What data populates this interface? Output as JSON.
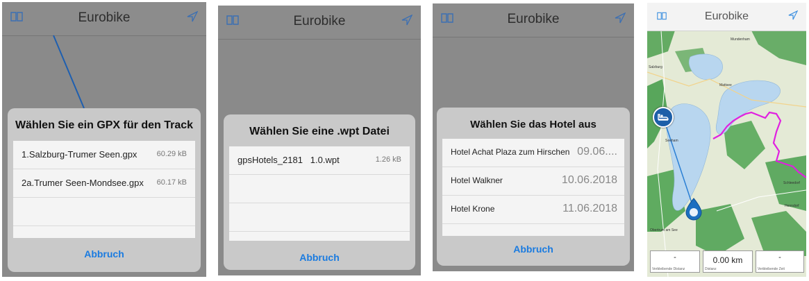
{
  "app_title": "Eurobike",
  "gpx_picker": {
    "title": "Wählen Sie ein GPX für den Track",
    "files": [
      {
        "name": "1.Salzburg-Trumer Seen.gpx",
        "size": "60.29 kB"
      },
      {
        "name": "2a.Trumer Seen-Mondsee.gpx",
        "size": "60.17 kB"
      }
    ],
    "cancel": "Abbruch"
  },
  "wpt_picker": {
    "title": "Wählen Sie eine .wpt Datei",
    "files": [
      {
        "name": "gpsHotels_2181   1.0.wpt",
        "size": "1.26 kB"
      }
    ],
    "cancel": "Abbruch"
  },
  "hotel_picker": {
    "title": "Wählen Sie das Hotel aus",
    "hotels": [
      {
        "name": "Hotel Achat Plaza zum Hirschen",
        "date": "09.06...."
      },
      {
        "name": "Hotel Walkner",
        "date": "10.06.2018"
      },
      {
        "name": "Hotel Krone",
        "date": "11.06.2018"
      }
    ],
    "cancel": "Abbruch"
  },
  "map": {
    "distance_value": "0.00 km",
    "remaining_distance_value": "-",
    "remaining_distance_label": "Verbleibende Distanz",
    "distance_label": "Distanz",
    "remaining_time_value": "-",
    "remaining_time_label": "Verbleibende Zeit",
    "place_labels": [
      "Salzburg",
      "Seeham",
      "Obertrum am See",
      "Mattsee",
      "Schleedorf",
      "Henndorf",
      "Mundenham"
    ],
    "colors": {
      "track": "#e020e0",
      "route_line": "#2a7fd4",
      "pin": "#1d6fc0",
      "water": "#b8d6ef",
      "forest": "#3f9a45"
    }
  }
}
